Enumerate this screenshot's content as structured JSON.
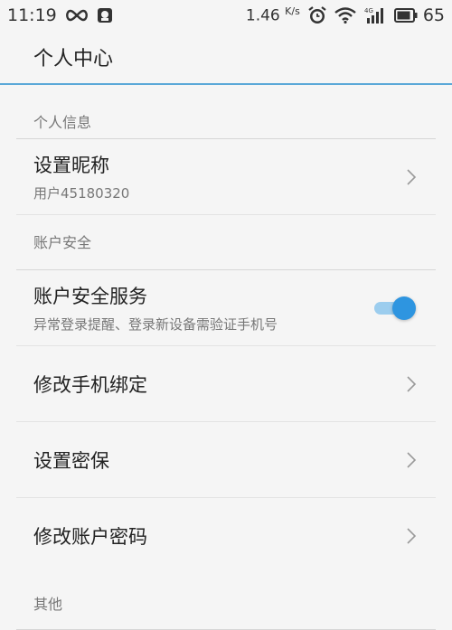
{
  "status_bar": {
    "time": "11:19",
    "net_speed_value": "1.46",
    "net_speed_unit": "K/s",
    "network_type": "4G",
    "battery": "65",
    "icons": [
      "infinity-icon",
      "qq-icon",
      "alarm-icon",
      "wifi-icon",
      "signal-icon",
      "battery-icon"
    ]
  },
  "app_bar": {
    "title": "个人中心"
  },
  "sections": {
    "personal": {
      "header": "个人信息",
      "nickname": {
        "title": "设置昵称",
        "subtitle": "用户45180320"
      }
    },
    "security": {
      "header": "账户安全",
      "security_service": {
        "title": "账户安全服务",
        "subtitle": "异常登录提醒、登录新设备需验证手机号",
        "enabled": true
      },
      "change_phone": {
        "title": "修改手机绑定"
      },
      "set_security_question": {
        "title": "设置密保"
      },
      "change_password": {
        "title": "修改账户密码"
      }
    },
    "other": {
      "header": "其他"
    }
  },
  "colors": {
    "accent": "#2e95e0",
    "accent_light": "#9ccdee",
    "app_bar_divider": "#5aa8d8",
    "background": "#f5f5f5"
  }
}
